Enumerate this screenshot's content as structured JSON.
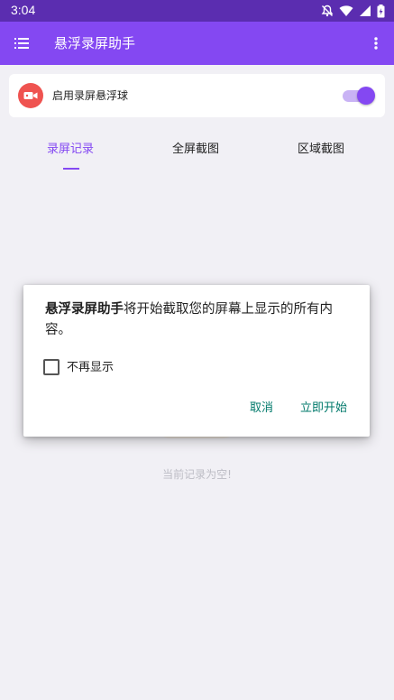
{
  "status_bar": {
    "time": "3:04",
    "icons": [
      "notifications-off-icon",
      "wifi-icon",
      "signal-icon",
      "battery-charging-icon"
    ]
  },
  "app_bar": {
    "title": "悬浮录屏助手",
    "menu_icon": "list-menu-icon",
    "more_icon": "more-vert-icon"
  },
  "floating_toggle": {
    "label": "启用录屏悬浮球",
    "icon": "video-camera-icon",
    "enabled": true
  },
  "tabs": [
    {
      "label": "录屏记录",
      "active": true
    },
    {
      "label": "全屏截图",
      "active": false
    },
    {
      "label": "区域截图",
      "active": false
    }
  ],
  "empty_state": "当前记录为空!",
  "dialog": {
    "app_name": "悬浮录屏助手",
    "message": "将开始截取您的屏幕上显示的所有内容。",
    "checkbox_label": "不再显示",
    "checkbox_checked": false,
    "cancel_label": "取消",
    "confirm_label": "立即开始"
  },
  "colors": {
    "status_bar": "#5b2db0",
    "primary": "#8448f2",
    "record_icon_bg": "#ef5350",
    "dialog_button": "#00796b",
    "background": "#f1f0f5"
  }
}
